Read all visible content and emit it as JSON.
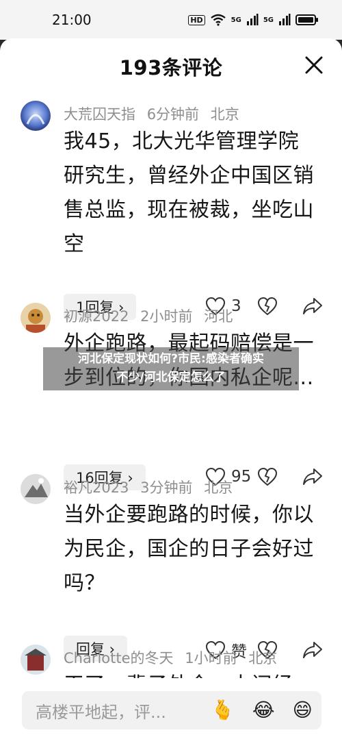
{
  "status_bar": {
    "time": "21:00",
    "hd_label": "HD",
    "signal_labels": [
      "5G",
      "5G"
    ]
  },
  "sheet": {
    "title": "193条评论",
    "comments": [
      {
        "username": "大荒囚天指",
        "time": "6分钟前",
        "location": "北京",
        "text": "我45，北大光华管理学院研究生，曾经外企中国区销售总监，现在被裁，坐吃山空",
        "reply_label": "1回复 ›",
        "likes": "3"
      },
      {
        "username": "初源2022",
        "time": "2小时前",
        "location": "河北",
        "text": "外企跑路，最起码赔偿是一步到位的，你国内私企呢...",
        "reply_label": "16回复 ›",
        "likes": "95"
      },
      {
        "username": "裕凡2023",
        "time": "3分钟前",
        "location": "北京",
        "text": "当外企要跑路的时候，你以为民企，国企的日子会好过吗？",
        "reply_label": "回复 ›",
        "likes": "赞"
      },
      {
        "username": "Charlotte的冬天",
        "time": "1小时前",
        "location": "北京",
        "text": "干了一辈子外企，中间经"
      }
    ]
  },
  "overlay": {
    "line1": "河北保定现状如何?市民:感染者确实",
    "line2": "不少/河北保定怎么了"
  },
  "input_bar": {
    "placeholder": "高楼平地起，评...",
    "emojis": [
      "🫰",
      "😂",
      "😄"
    ]
  },
  "colors": {
    "background": "#ffffff",
    "meta_text": "#8e8e8e",
    "pill_bg": "#f0f0f0"
  }
}
